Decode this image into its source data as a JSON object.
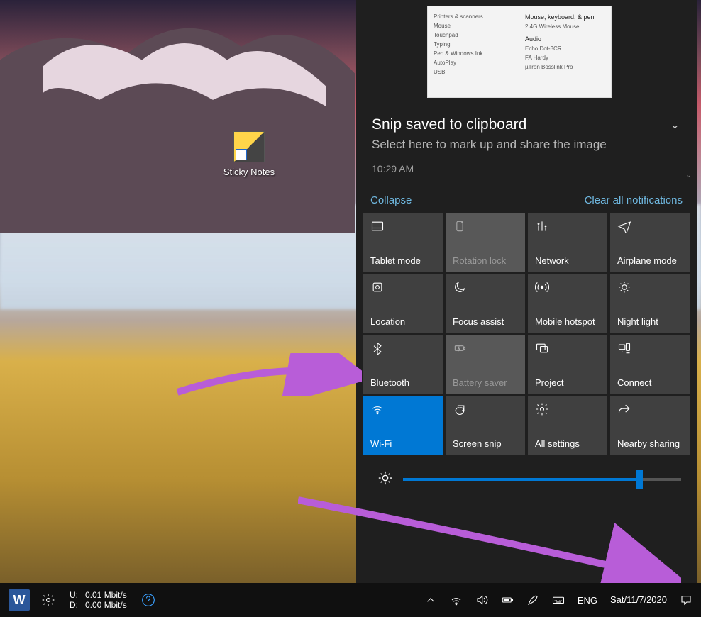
{
  "desktop": {
    "icons": [
      {
        "label": "Sticky Notes"
      }
    ]
  },
  "actionCenter": {
    "preview": {
      "left": [
        "Printers & scanners",
        "Mouse",
        "Touchpad",
        "Typing",
        "Pen & Windows Ink",
        "AutoPlay",
        "USB"
      ],
      "rightHeading1": "Mouse, keyboard, & pen",
      "right1": [
        "2.4G Wireless Mouse"
      ],
      "rightHeading2": "Audio",
      "right2": [
        "Echo Dot-3CR",
        "FA Hardy",
        "µTron Bosslink Pro"
      ]
    },
    "notification": {
      "title": "Snip saved to clipboard",
      "body": "Select here to mark up and share the image",
      "time": "10:29 AM"
    },
    "collapseLabel": "Collapse",
    "clearLabel": "Clear all notifications",
    "tiles": [
      {
        "label": "Tablet mode",
        "icon": "tablet",
        "state": "normal"
      },
      {
        "label": "Rotation lock",
        "icon": "rotation",
        "state": "dim"
      },
      {
        "label": "Network",
        "icon": "network",
        "state": "normal"
      },
      {
        "label": "Airplane mode",
        "icon": "airplane",
        "state": "normal"
      },
      {
        "label": "Location",
        "icon": "location",
        "state": "normal"
      },
      {
        "label": "Focus assist",
        "icon": "moon",
        "state": "normal"
      },
      {
        "label": "Mobile hotspot",
        "icon": "hotspot",
        "state": "normal"
      },
      {
        "label": "Night light",
        "icon": "nightlight",
        "state": "normal"
      },
      {
        "label": "Bluetooth",
        "icon": "bluetooth",
        "state": "normal"
      },
      {
        "label": "Battery saver",
        "icon": "battery",
        "state": "dim"
      },
      {
        "label": "Project",
        "icon": "project",
        "state": "normal"
      },
      {
        "label": "Connect",
        "icon": "connect",
        "state": "normal"
      },
      {
        "label": "Wi-Fi",
        "icon": "wifi",
        "state": "active"
      },
      {
        "label": "Screen snip",
        "icon": "snip",
        "state": "normal"
      },
      {
        "label": "All settings",
        "icon": "settings",
        "state": "normal"
      },
      {
        "label": "Nearby sharing",
        "icon": "share",
        "state": "normal"
      }
    ],
    "brightnessPercent": 85
  },
  "taskbar": {
    "netStats": {
      "upLabel": "U:",
      "upValue": "0.01 Mbit/s",
      "downLabel": "D:",
      "downValue": "0.00 Mbit/s"
    },
    "language": "ENG",
    "time": "",
    "date": "Sat/11/7/2020"
  }
}
